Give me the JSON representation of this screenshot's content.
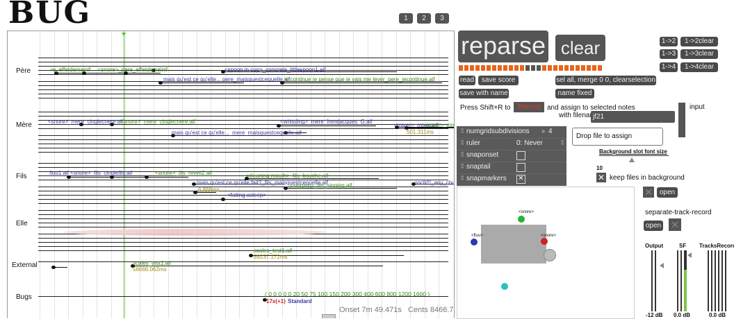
{
  "logo": {
    "text": "BUG"
  },
  "page_tabs": [
    "1",
    "2",
    "3"
  ],
  "score": {
    "voices": [
      {
        "name": "Père"
      },
      {
        "name": "Mère"
      },
      {
        "name": "Fils"
      },
      {
        "name": "Elle"
      },
      {
        "name": "External"
      },
      {
        "name": "Bugs"
      }
    ],
    "pere_labels": [
      "re_effetdemainif",
      "<snore>_pere_effetdemainif",
      "<spoon in cup>_concrete_littlespoon1.aif",
      "mais qu'est ce qu'elle... pere_maisquestcequelle.aif",
      "je continue je pense que je vais me lever_pere_jecontinue.aif"
    ],
    "mere_labels": [
      "<snore>_mere_cinglecnere.aif",
      "<snore>_mere_cinglecnere.aif",
      "<whistling>_mere_frerejacques_G.aif",
      "<mixer>_mixer.aif",
      "<mixer>_mixer.aif",
      "mais qu'est ce qu'elle..._mere_maisquestcequelle.aif",
      "501.311ms"
    ],
    "fils_labels": [
      "fluu1.aif <snore>_fils_cinglefils.aif",
      "<snore>_fils_reveil2.aif",
      "<cleaning mouth>_fils_bouche.aif",
      "mais qu'est ce qu'elle fait?_fils_maisquestcequelle.aif",
      "<singing>_fils_singing.aif",
      "ssch!!!_any_chucht",
      "6.868ms",
      "<falling asleep>"
    ],
    "external_labels": [
      "scales_test1.aif",
      "69237.172ms",
      "scales_test1.aif",
      "56666.062ms"
    ],
    "bugs_seq": "( 0 0 0 0 0 20 50 75 100 150 200 300 400 600 800 1200 1600 )",
    "bugs_red": "17x(+1)",
    "bugs_standard": "Standard",
    "status": "Onset 7m 49.471s   Cents 8466.7"
  },
  "controls": {
    "reparse": "reparse",
    "clear": "clear",
    "merge_buttons": [
      "1->2",
      "1->2clear",
      "1->3",
      "1->3clear",
      "1->4",
      "1->4clear"
    ],
    "read": "read",
    "save_score": "save score",
    "sel_all": "sel all, merge 0 0, clearselection",
    "save_with_name": "save with name",
    "name_fixed": "name fixed",
    "press_text": "Press Shift+R to",
    "record": "Record",
    "assign_text": "and assign to selected notes",
    "with_filename": "with filename:",
    "filename_value": "jf21",
    "input_label": "input",
    "inspector": {
      "numgrid_label": "numgridsubdivisions",
      "numgrid_value": "4",
      "ruler_label": "ruler",
      "ruler_value": "0: Never",
      "snaponset": "snaponset",
      "snaptail": "snaptail",
      "snapmarkers": "snapmarkers"
    },
    "drop_file": "Drop file to assign",
    "bg_font_label": "Background slot font size",
    "bg_font_value": "10",
    "keep_files": "keep files in background",
    "open1": "open",
    "separate_track": "separate-track-record",
    "open2": "open",
    "spat_labels": [
      "<snore>",
      "<fluu>",
      "<snore>"
    ],
    "meters": {
      "output": "Output",
      "sf": "SF",
      "tracks": "TracksRecord",
      "output_db": "-12 dB",
      "sf_db": "0.0 dB",
      "tracks_db": "0.0 dB"
    },
    "colors": {
      "orange": "#e8641a",
      "record": "#e23a2a",
      "panel": "#555555",
      "accent_green": "#5bbd2b"
    }
  }
}
